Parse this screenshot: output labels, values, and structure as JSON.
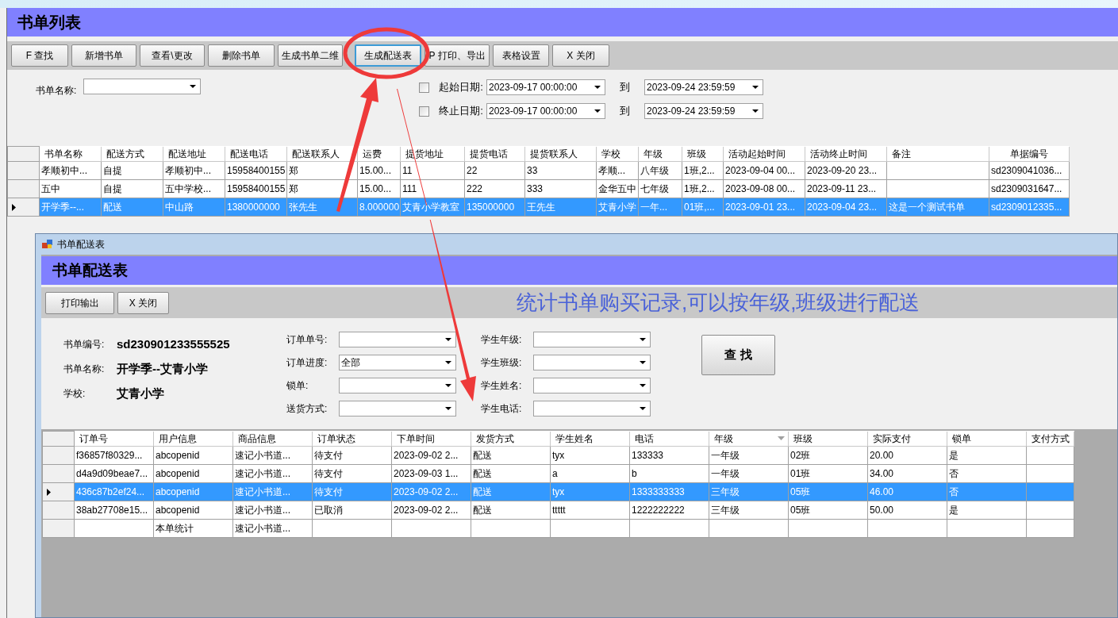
{
  "main_window": {
    "title": "书单列表",
    "toolbar": [
      {
        "label": "F 查找",
        "focused": false
      },
      {
        "label": "新增书单",
        "focused": false
      },
      {
        "label": "查看\\更改",
        "focused": false
      },
      {
        "label": "删除书单",
        "focused": false
      },
      {
        "label": "生成书单二维",
        "focused": false
      },
      {
        "label": "生成配送表",
        "focused": true
      },
      {
        "label": "P 打印、导出",
        "focused": false
      },
      {
        "label": "表格设置",
        "focused": false
      },
      {
        "label": "X 关闭",
        "focused": false
      }
    ],
    "book_name_filter": {
      "label": "书单名称:"
    },
    "date_filters": [
      {
        "label": "起始日期:",
        "checked": false,
        "from": "2023-09-17 00:00:00",
        "to_label": "到",
        "to": "2023-09-24 23:59:59"
      },
      {
        "label": "终止日期:",
        "checked": false,
        "from": "2023-09-17 00:00:00",
        "to_label": "到",
        "to": "2023-09-24 23:59:59"
      }
    ],
    "table": {
      "columns": [
        "书单名称",
        "配送方式",
        "配送地址",
        "配送电话",
        "配送联系人",
        "运费",
        "提货地址",
        "提货电话",
        "提货联系人",
        "学校",
        "年级",
        "班级",
        "活动起始时间",
        "活动终止时间",
        "备注",
        "单据编号"
      ],
      "rows": [
        {
          "selected": false,
          "cells": [
            "孝顺初中...",
            "自提",
            "孝顺初中...",
            "15958400155",
            "郑",
            "15.00...",
            "11",
            "22",
            "33",
            "孝顺...",
            "八年级",
            "1班,2...",
            "2023-09-04 00...",
            "2023-09-20 23...",
            null,
            "sd2309041036..."
          ]
        },
        {
          "selected": false,
          "cells": [
            "五中",
            "自提",
            "五中学校...",
            "15958400155",
            "郑",
            "15.00...",
            "111",
            "222",
            "333",
            "金华五中",
            "七年级",
            "1班,2...",
            "2023-09-08 00...",
            "2023-09-11 23...",
            null,
            "sd2309031647..."
          ]
        },
        {
          "selected": true,
          "cells": [
            "开学季--...",
            "配送",
            "中山路",
            "1380000000",
            "张先生",
            "8.000000",
            "艾青小学教室",
            "135000000",
            "王先生",
            "艾青小学",
            "一年...",
            "01班,...",
            "2023-09-01 23...",
            "2023-09-04 23...",
            "这是一个测试书单",
            "sd2309012335..."
          ]
        }
      ]
    }
  },
  "dialog": {
    "window_title": "书单配送表",
    "title": "书单配送表",
    "toolbar": [
      {
        "label": "打印输出"
      },
      {
        "label": "X 关闭"
      }
    ],
    "annotation": "统计书单购买记录,可以按年级,班级进行配送",
    "info": [
      {
        "label": "书单编号:",
        "value": "sd230901233555525"
      },
      {
        "label": "书单名称:",
        "value": "开学季--艾青小学"
      },
      {
        "label": "学校:",
        "value": "艾青小学"
      }
    ],
    "filters_left": [
      {
        "label": "订单单号:"
      },
      {
        "label": "订单进度:",
        "value": "全部"
      },
      {
        "label": "锁单:"
      },
      {
        "label": "送货方式:"
      }
    ],
    "filters_right": [
      {
        "label": "学生年级:"
      },
      {
        "label": "学生班级:"
      },
      {
        "label": "学生姓名:"
      },
      {
        "label": "学生电话:"
      }
    ],
    "search_button": "查 找",
    "table": {
      "columns": [
        {
          "label": "订单号",
          "sorted": false
        },
        {
          "label": "用户信息",
          "sorted": false
        },
        {
          "label": "商品信息",
          "sorted": false
        },
        {
          "label": "订单状态",
          "sorted": false
        },
        {
          "label": "下单时间",
          "sorted": false
        },
        {
          "label": "发货方式",
          "sorted": false
        },
        {
          "label": "学生姓名",
          "sorted": false
        },
        {
          "label": "电话",
          "sorted": false
        },
        {
          "label": "年级",
          "sorted": true
        },
        {
          "label": "班级",
          "sorted": false
        },
        {
          "label": "实际支付",
          "sorted": false
        },
        {
          "label": "锁单",
          "sorted": false
        },
        {
          "label": "支付方式",
          "sorted": false
        }
      ],
      "rows": [
        {
          "selected": false,
          "cells": [
            "f36857f80329...",
            "abcopenid",
            "速记小书道...",
            "待支付",
            "2023-09-02 2...",
            "配送",
            "tyx",
            "133333",
            "一年级",
            "02班",
            "20.00",
            "是",
            null
          ]
        },
        {
          "selected": false,
          "cells": [
            "d4a9d09beae7...",
            "abcopenid",
            "速记小书道...",
            "待支付",
            "2023-09-03 1...",
            "配送",
            "a",
            "b",
            "一年级",
            "01班",
            "34.00",
            "否",
            null
          ]
        },
        {
          "selected": true,
          "cells": [
            "436c87b2ef24...",
            "abcopenid",
            "速记小书道...",
            "待支付",
            "2023-09-02 2...",
            "配送",
            "tyx",
            "1333333333",
            "三年级",
            "05班",
            "46.00",
            "否",
            null
          ]
        },
        {
          "selected": false,
          "cells": [
            "38ab27708e15...",
            "abcopenid",
            "速记小书道...",
            "已取消",
            "2023-09-02 2...",
            "配送",
            "ttttt",
            "1222222222",
            "三年级",
            "05班",
            "50.00",
            "是",
            null
          ]
        },
        {
          "selected": false,
          "cells": [
            null,
            "本单统计",
            "速记小书道...",
            null,
            null,
            null,
            null,
            null,
            null,
            null,
            null,
            null,
            null
          ]
        }
      ]
    }
  }
}
